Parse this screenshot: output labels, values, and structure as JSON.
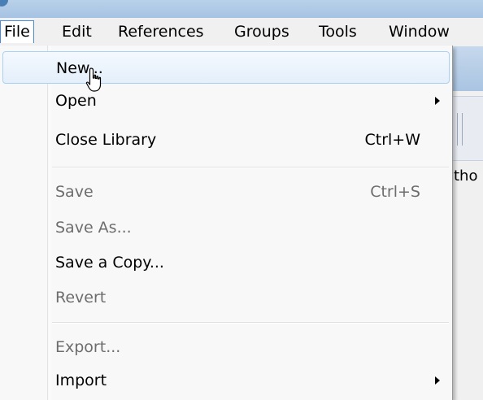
{
  "menubar": {
    "items": [
      {
        "label": "File",
        "active": true
      },
      {
        "label": "Edit"
      },
      {
        "label": "References"
      },
      {
        "label": "Groups"
      },
      {
        "label": "Tools"
      },
      {
        "label": "Window"
      }
    ]
  },
  "background": {
    "column_text": "tho"
  },
  "file_menu": {
    "items": [
      {
        "label": "New...",
        "state": "hover"
      },
      {
        "label": "Open",
        "submenu": true
      },
      {
        "label": "Close Library",
        "shortcut": "Ctrl+W"
      },
      {
        "label": "Save",
        "shortcut": "Ctrl+S",
        "disabled": true
      },
      {
        "label": "Save As...",
        "disabled": true
      },
      {
        "label": "Save a Copy..."
      },
      {
        "label": "Revert",
        "disabled": true
      },
      {
        "label": "Export...",
        "disabled": true
      },
      {
        "label": "Import",
        "submenu": true
      }
    ]
  },
  "colors": {
    "menu_highlight_border": "#a8d1f5",
    "active_menu_border": "#4b8bd6",
    "disabled_text": "#6d6d6d"
  }
}
